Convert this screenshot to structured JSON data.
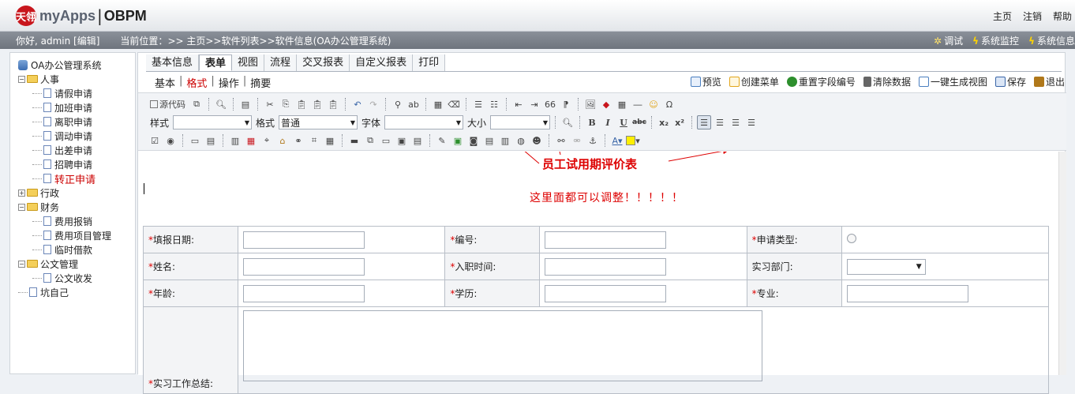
{
  "topbar": {
    "logo_mark": "天翎",
    "logo_text": "myApps",
    "logo_sep": "|",
    "logo_text2": "OBPM",
    "links": [
      "主页",
      "注销",
      "帮助"
    ]
  },
  "infobar": {
    "greeting": "你好, admin [编辑]",
    "location_label": "当前位置：",
    "crumb": ">> 主页>>软件列表>>软件信息(OA办公管理系统)",
    "right": [
      {
        "icon": "gear-icon",
        "label": "调试"
      },
      {
        "icon": "bolt-icon",
        "label": "系统监控"
      },
      {
        "icon": "bolt-icon",
        "label": "系统信息"
      }
    ]
  },
  "tree": {
    "root": "OA办公管理系统",
    "items": [
      {
        "label": "人事",
        "type": "folder",
        "expanded": true,
        "children": [
          "请假申请",
          "加班申请",
          "离职申请",
          "调动申请",
          "出差申请",
          "招聘申请",
          "转正申请"
        ],
        "active": "转正申请"
      },
      {
        "label": "行政",
        "type": "folder",
        "expanded": false,
        "children": []
      },
      {
        "label": "财务",
        "type": "folder",
        "expanded": true,
        "children": [
          "费用报销",
          "费用项目管理",
          "临时借款"
        ]
      },
      {
        "label": "公文管理",
        "type": "folder",
        "expanded": true,
        "children": [
          "公文收发"
        ]
      },
      {
        "label": "坑自己",
        "type": "doc"
      }
    ]
  },
  "tabs": [
    "基本信息",
    "表单",
    "视图",
    "流程",
    "交叉报表",
    "自定义报表",
    "打印"
  ],
  "active_tab": "表单",
  "subtabs": [
    "基本",
    "格式",
    "操作",
    "摘要"
  ],
  "active_subtab": "格式",
  "actions": [
    {
      "icon": "preview-icon",
      "label": "预览",
      "color": "#4a7fc0"
    },
    {
      "icon": "menu-icon",
      "label": "创建菜单",
      "color": "#e2a61c"
    },
    {
      "icon": "refresh-icon",
      "label": "重置字段编号",
      "color": "#2d8f2d"
    },
    {
      "icon": "trash-icon",
      "label": "清除数据",
      "color": "#666666"
    },
    {
      "icon": "view-icon",
      "label": "一键生成视图",
      "color": "#4a7fc0"
    },
    {
      "icon": "save-icon",
      "label": "保存",
      "color": "#3a66a8"
    },
    {
      "icon": "exit-icon",
      "label": "退出",
      "color": "#b0781a"
    }
  ],
  "editor_toolbar": {
    "source_label": "源代码",
    "style_label": "样式",
    "format_label": "格式",
    "format_value": "普通",
    "font_label": "字体",
    "size_label": "大小",
    "bold": "B",
    "italic": "I",
    "underline": "U",
    "strike": "abc",
    "sub": "x₂",
    "sup": "x²",
    "omega": "Ω",
    "quote": "66"
  },
  "content": {
    "title": "员工试用期评价表",
    "note": "这里面都可以调整！！！！！",
    "rows": [
      [
        {
          "label": "填报日期:",
          "req": true,
          "field": "input"
        },
        {
          "label": "编号:",
          "req": true,
          "field": "input"
        },
        {
          "label": "申请类型:",
          "req": true,
          "field": "radio"
        }
      ],
      [
        {
          "label": "姓名:",
          "req": true,
          "field": "input"
        },
        {
          "label": "入职时间:",
          "req": true,
          "field": "input"
        },
        {
          "label": "实习部门:",
          "req": false,
          "field": "select"
        }
      ],
      [
        {
          "label": "年龄:",
          "req": true,
          "field": "input"
        },
        {
          "label": "学历:",
          "req": true,
          "field": "input"
        },
        {
          "label": "专业:",
          "req": true,
          "field": "input"
        }
      ]
    ],
    "summary_label": "实习工作总结:",
    "req_mark": "*"
  }
}
